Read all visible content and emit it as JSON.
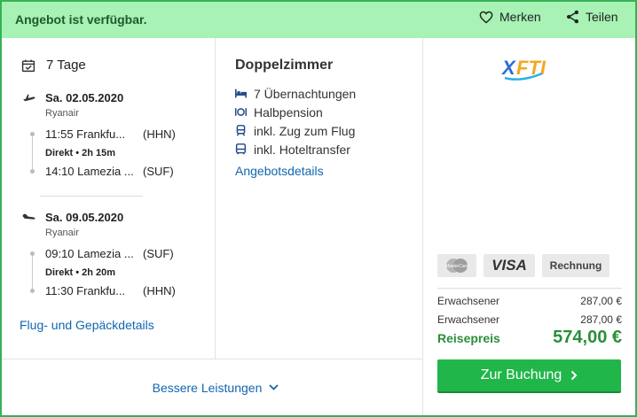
{
  "header": {
    "availability": "Angebot ist verfügbar.",
    "save_label": "Merken",
    "share_label": "Teilen"
  },
  "flight": {
    "duration": "7 Tage",
    "outbound": {
      "date": "Sa. 02.05.2020",
      "airline": "Ryanair",
      "dep_time_city": "11:55 Frankfu...",
      "dep_code": "(HHN)",
      "stop": "Direkt  •  2h 15m",
      "arr_time_city": "14:10 Lamezia ...",
      "arr_code": "(SUF)"
    },
    "return": {
      "date": "Sa. 09.05.2020",
      "airline": "Ryanair",
      "dep_time_city": "09:10 Lamezia ...",
      "dep_code": "(SUF)",
      "stop": "Direkt  •  2h 20m",
      "arr_time_city": "11:30 Frankfu...",
      "arr_code": "(HHN)"
    },
    "details_link": "Flug- und Gepäckdetails"
  },
  "hotel": {
    "room": "Doppelzimmer",
    "features": [
      {
        "icon": "bed-icon",
        "label": "7 Übernachtungen"
      },
      {
        "icon": "meal-icon",
        "label": "Halbpension"
      },
      {
        "icon": "train-icon",
        "label": "inkl. Zug zum Flug"
      },
      {
        "icon": "bus-icon",
        "label": "inkl. Hoteltransfer"
      }
    ],
    "details_link": "Angebotsdetails"
  },
  "pricing": {
    "operator_logo": "XFT!",
    "payment_methods": [
      "MasterCard",
      "VISA",
      "Rechnung"
    ],
    "rows": [
      {
        "label": "Erwachsener",
        "price": "287,00 €"
      },
      {
        "label": "Erwachsener",
        "price": "287,00 €"
      }
    ],
    "total_label": "Reisepreis",
    "total_price": "574,00 €",
    "book_label": "Zur Buchung"
  },
  "footer": {
    "more_services": "Bessere Leistungen"
  },
  "colors": {
    "accent_green": "#21b64a",
    "banner_green": "#a7f2b4",
    "link_blue": "#1166b0"
  }
}
